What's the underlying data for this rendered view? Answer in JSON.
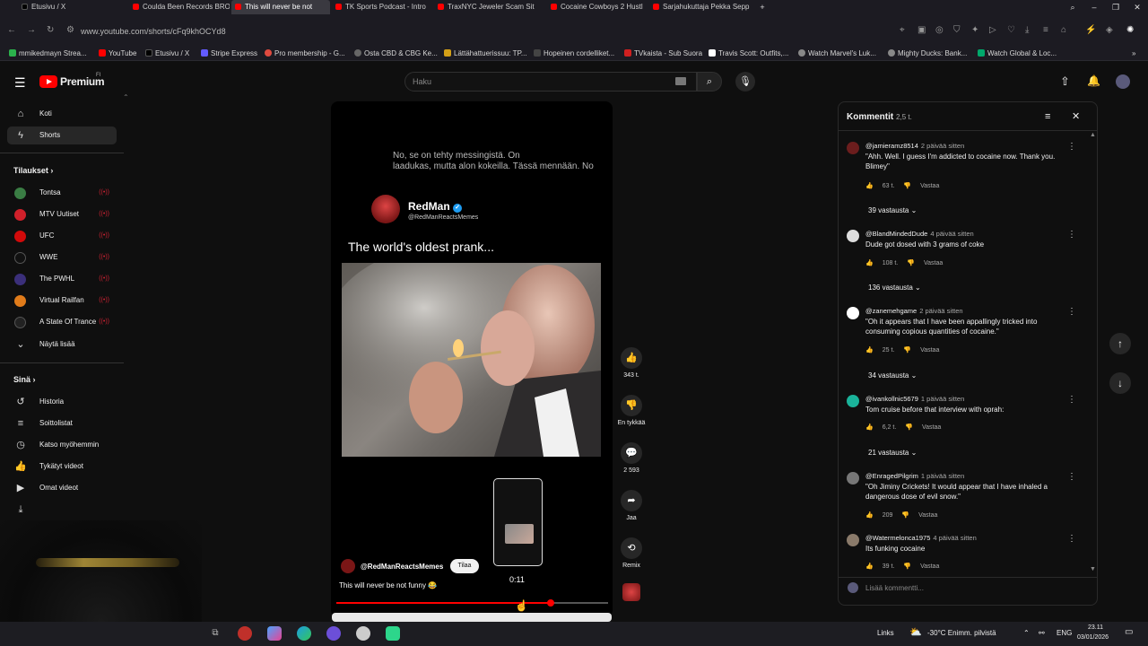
{
  "browser": {
    "tabs": [
      {
        "label": "Etusivu / X",
        "color": "#000000"
      },
      {
        "label": "Coulda Been Records BRO",
        "color": "#ff0000"
      },
      {
        "label": "This will never be not",
        "color": "#ff0000"
      },
      {
        "label": "TK Sports Podcast - Intro",
        "color": "#ff0000"
      },
      {
        "label": "TraxNYC Jeweler Scam Sit",
        "color": "#ff0000"
      },
      {
        "label": "Cocaine Cowboys 2 Hustl",
        "color": "#ff0000"
      },
      {
        "label": "Sarjahukuttaja Pekka Sepp",
        "color": "#ff0000"
      }
    ],
    "url": "www.youtube.com/shorts/cFq9khOCYd8",
    "bookmarks": [
      {
        "label": "mmikedmayn Strea...",
        "color": "#2bb24c"
      },
      {
        "label": "YouTube",
        "color": "#ff0000"
      },
      {
        "label": "Etusivu / X",
        "color": "#000000"
      },
      {
        "label": "Stripe Express",
        "color": "#635bff"
      },
      {
        "label": "Pro membership - G...",
        "color": "#e04a3f"
      },
      {
        "label": "Osta CBD & CBG Ke...",
        "color": "#666666"
      },
      {
        "label": "Lättähattuerissuu: TP...",
        "color": "#d4a017"
      },
      {
        "label": "Hopeinen cordelliket...",
        "color": "#444444"
      },
      {
        "label": "TVkaista - Sub Suora",
        "color": "#d02020"
      },
      {
        "label": "Travis Scott: Outfits,...",
        "color": "#ffffff"
      },
      {
        "label": "Watch Marvel's Luk...",
        "color": "#888888"
      },
      {
        "label": "Mighty Ducks: Bank...",
        "color": "#888888"
      },
      {
        "label": "Watch Global & Loc...",
        "color": "#00a86b"
      }
    ]
  },
  "header": {
    "logo_text": "Premium",
    "logo_sup": "FI",
    "search_placeholder": "Haku"
  },
  "sidebar": {
    "main": [
      {
        "label": "Koti",
        "icon": "home-icon"
      },
      {
        "label": "Shorts",
        "icon": "shorts-icon"
      }
    ],
    "subs_title": "Tilaukset",
    "subs": [
      {
        "label": "Tontsa",
        "color": "#3a7d44"
      },
      {
        "label": "MTV Uutiset",
        "color": "#d0202a"
      },
      {
        "label": "UFC",
        "color": "#d20a0a"
      },
      {
        "label": "WWE",
        "color": "#111111"
      },
      {
        "label": "The PWHL",
        "color": "#3b2f7a"
      },
      {
        "label": "Virtual Railfan",
        "color": "#e07b1a"
      },
      {
        "label": "A State Of Trance",
        "color": "#222222"
      }
    ],
    "show_more": "Näytä lisää",
    "you_title": "Sinä",
    "you": [
      {
        "label": "Historia",
        "icon": "history-icon"
      },
      {
        "label": "Soittolistat",
        "icon": "playlists-icon"
      },
      {
        "label": "Katso myöhemmin",
        "icon": "watch-later-icon"
      },
      {
        "label": "Tykätyt videot",
        "icon": "like-icon"
      },
      {
        "label": "Omat videot",
        "icon": "my-videos-icon"
      }
    ]
  },
  "video": {
    "caption_line1": "No, se on tehty messingistä.  On",
    "caption_line2": "laadukas, mutta alon kokeilla.  Tässä mennään.  No",
    "poster_name": "RedMan",
    "poster_handle": "@RedManReactsMemes",
    "title_text": "The world's oldest prank...",
    "thumb_time": "0:11",
    "channel": "@RedManReactsMemes",
    "subscribe": "Tilaa",
    "description": "This will never be not funny 😂",
    "progress": 0.79
  },
  "actions": {
    "like_count": "343 t.",
    "dislike_label": "En tykkää",
    "comments_count": "2 593",
    "share_label": "Jaa",
    "remix_label": "Remix"
  },
  "comments": {
    "title": "Kommentit",
    "count": "2,5 t.",
    "reply_label": "Vastaa",
    "add_placeholder": "Lisää kommentti...",
    "items": [
      {
        "user": "@jamieramz8514",
        "ago": "2 päivää sitten",
        "text": "\"Ahh. Well. I guess I'm addicted to cocaine now. Thank you. Blimey\"",
        "likes": "63 t.",
        "replies": "39 vastausta",
        "color": "#6b1d1d"
      },
      {
        "user": "@BlandMindedDude",
        "ago": "4 päivää sitten",
        "text": "Dude got dosed with 3 grams of coke",
        "likes": "108 t.",
        "replies": "136 vastausta",
        "color": "#dddddd"
      },
      {
        "user": "@zanemehgame",
        "ago": "2 päivää sitten",
        "text": "\"Oh it appears that I have been appallingly tricked into consuming copious quantities of cocaine.\"",
        "likes": "25 t.",
        "replies": "34 vastausta",
        "color": "#ffffff"
      },
      {
        "user": "@ivankollnic5679",
        "ago": "1 päivää sitten",
        "text": "Tom cruise before that interview with oprah:",
        "likes": "6,2 t.",
        "replies": "21 vastausta",
        "color": "#1ab39a"
      },
      {
        "user": "@EnragedPilgrim",
        "ago": "1 päivää sitten",
        "text": "\"Oh Jiminy Crickets! It would appear that I have inhaled a dangerous dose of evil snow.\"",
        "likes": "209",
        "replies": "",
        "color": "#777777"
      },
      {
        "user": "@Watermelonca1975",
        "ago": "4 päivää sitten",
        "text": "Its funking cocaine",
        "likes": "39 t.",
        "replies": "",
        "color": "#8a7a6a"
      }
    ]
  },
  "taskbar": {
    "links": "Links",
    "weather": "-30°C  Enimm. pilvistä",
    "lang": "ENG",
    "time": "23.11",
    "date": "03/01/2026"
  }
}
